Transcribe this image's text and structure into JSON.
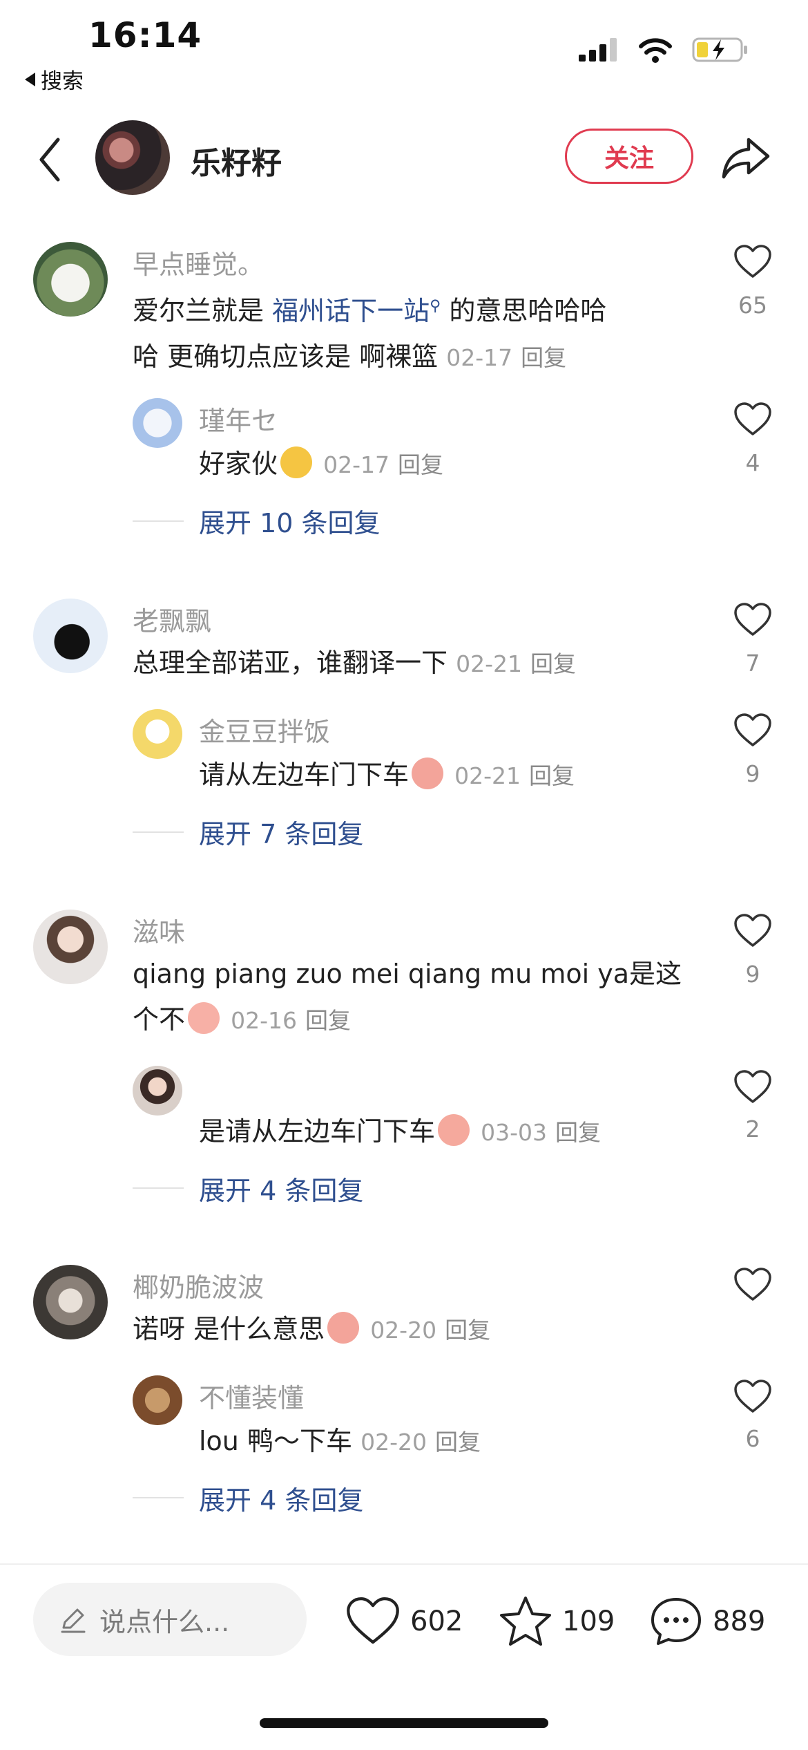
{
  "status_bar": {
    "time": "16:14",
    "back_label": "搜索"
  },
  "header": {
    "author_name": "乐籽籽",
    "follow_label": "关注"
  },
  "comments": [
    {
      "username": "早点睡觉。",
      "text_parts": [
        "爱尔兰就是 ",
        "福州话下一站",
        " 的意思哈哈哈",
        "哈 更确切点应该是 啊裸篮"
      ],
      "date": "02-17",
      "reply_label": "回复",
      "likes": "65",
      "replies": [
        {
          "username": "瑾年セ",
          "text": "好家伙",
          "emoji": "face-emoji",
          "date": "02-17",
          "reply_label": "回复",
          "likes": "4"
        }
      ],
      "expand_label": "展开 10 条回复"
    },
    {
      "username": "老飘飘",
      "text": "总理全部诺亚，谁翻译一下",
      "date": "02-21",
      "reply_label": "回复",
      "likes": "7",
      "replies": [
        {
          "username": "金豆豆拌饭",
          "text": "请从左边车门下车",
          "emoji": "crying-emoji",
          "date": "02-21",
          "reply_label": "回复",
          "likes": "9"
        }
      ],
      "expand_label": "展开 7 条回复"
    },
    {
      "username": "滋味",
      "text_line1": "qiang piang zuo mei qiang mu moi ya是这",
      "text_line2": "个不",
      "emoji": "teary-emoji",
      "date": "02-16",
      "reply_label": "回复",
      "likes": "9",
      "replies": [
        {
          "username": "",
          "text": "是请从左边车门下车",
          "emoji": "kiss-emoji",
          "date": "03-03",
          "reply_label": "回复",
          "likes": "2"
        }
      ],
      "expand_label": "展开 4 条回复"
    },
    {
      "username": "椰奶脆波波",
      "text": "诺呀 是什么意思",
      "emoji": "crying-emoji",
      "date": "02-20",
      "reply_label": "回复",
      "likes": "",
      "replies": [
        {
          "username": "不懂装懂",
          "text": "lou 鸭～下车",
          "date": "02-20",
          "reply_label": "回复",
          "likes": "6"
        }
      ],
      "expand_label": "展开 4 条回复"
    }
  ],
  "bottom_bar": {
    "input_placeholder": "说点什么...",
    "likes": "602",
    "stars": "109",
    "comments": "889"
  },
  "colors": {
    "accent": "#e03b50",
    "link": "#2f4f8f",
    "muted": "#9a9a9a"
  }
}
